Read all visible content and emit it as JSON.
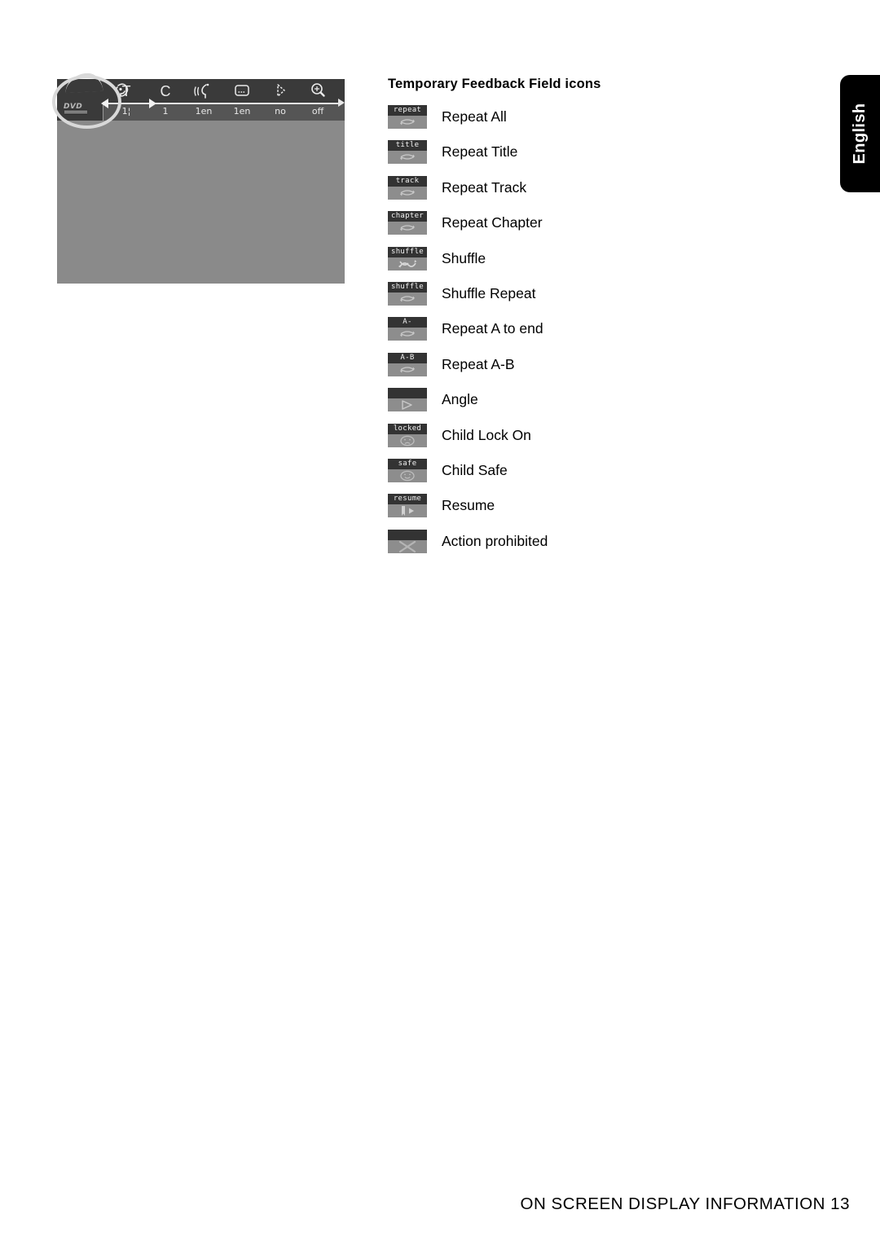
{
  "osd": {
    "disc_type_label": "DVD",
    "fields": [
      {
        "symbol": "face-profile-icon",
        "value": ""
      },
      {
        "symbol": "T",
        "value": "1¦"
      },
      {
        "symbol": "C",
        "value": "1"
      },
      {
        "symbol": "audio-language-icon",
        "value": "1en"
      },
      {
        "symbol": "subtitle-icon",
        "value": "1en"
      },
      {
        "symbol": "angle-icon",
        "value": "no"
      },
      {
        "symbol": "zoom-icon",
        "value": "off"
      }
    ]
  },
  "feedback": {
    "title": "Temporary Feedback Field icons",
    "items": [
      {
        "cap": "repeat",
        "glyph": "loop-arrow-icon",
        "label": "Repeat All"
      },
      {
        "cap": "title",
        "glyph": "loop-arrow-icon",
        "label": "Repeat Title"
      },
      {
        "cap": "track",
        "glyph": "loop-arrow-icon",
        "label": "Repeat Track"
      },
      {
        "cap": "chapter",
        "glyph": "loop-arrow-icon",
        "label": "Repeat Chapter"
      },
      {
        "cap": "shuffle",
        "glyph": "shuffle-arrows-icon",
        "label": "Shuffle"
      },
      {
        "cap": "shuffle",
        "glyph": "loop-arrow-icon",
        "label": "Shuffle Repeat"
      },
      {
        "cap": "A-",
        "glyph": "loop-arrow-icon",
        "label": "Repeat A to end"
      },
      {
        "cap": "A-B",
        "glyph": "loop-arrow-icon",
        "label": "Repeat A-B"
      },
      {
        "cap": "",
        "glyph": "angle-arrow-icon",
        "label": "Angle"
      },
      {
        "cap": "locked",
        "glyph": "sad-face-icon",
        "label": "Child Lock On"
      },
      {
        "cap": "safe",
        "glyph": "smiley-face-icon",
        "label": "Child Safe"
      },
      {
        "cap": "resume",
        "glyph": "resume-play-icon",
        "label": "Resume"
      },
      {
        "cap": "",
        "glyph": "cross-prohibited-icon",
        "label": "Action prohibited"
      }
    ]
  },
  "language_tab": {
    "label": "English"
  },
  "footer": {
    "text": "ON SCREEN DISPLAY INFORMATION  13"
  },
  "colors": {
    "screen_body": "#8a8a8a",
    "bar_top": "#3a3a3a",
    "bar_bottom": "#555555",
    "icon_body": "#8d8d8d",
    "icon_cap": "#333333",
    "highlight_ring": "#d9d9d9",
    "tab_background": "#000000"
  }
}
